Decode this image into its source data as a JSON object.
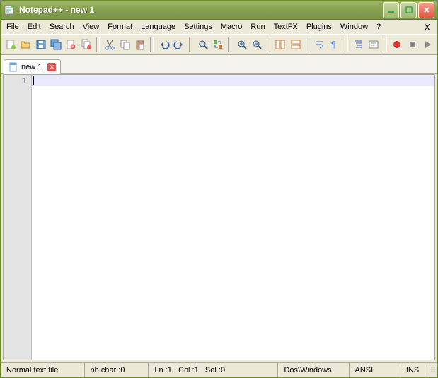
{
  "titlebar": {
    "app_name": "Notepad++",
    "separator": " - ",
    "document": "new 1"
  },
  "menu": {
    "file": "File",
    "edit": "Edit",
    "search": "Search",
    "view": "View",
    "format": "Format",
    "language": "Language",
    "settings": "Settings",
    "macro": "Macro",
    "run": "Run",
    "textfx": "TextFX",
    "plugins": "Plugins",
    "window": "Window",
    "help": "?"
  },
  "tabs": {
    "active_label": "new 1"
  },
  "editor": {
    "line_numbers": [
      "1"
    ]
  },
  "status": {
    "filetype": "Normal text file",
    "nbchar_label": "nb char : ",
    "nbchar_value": "0",
    "ln_label": "Ln : ",
    "ln_value": "1",
    "col_label": "Col : ",
    "col_value": "1",
    "sel_label": "Sel : ",
    "sel_value": "0",
    "eol": "Dos\\Windows",
    "encoding": "ANSI",
    "mode": "INS"
  }
}
